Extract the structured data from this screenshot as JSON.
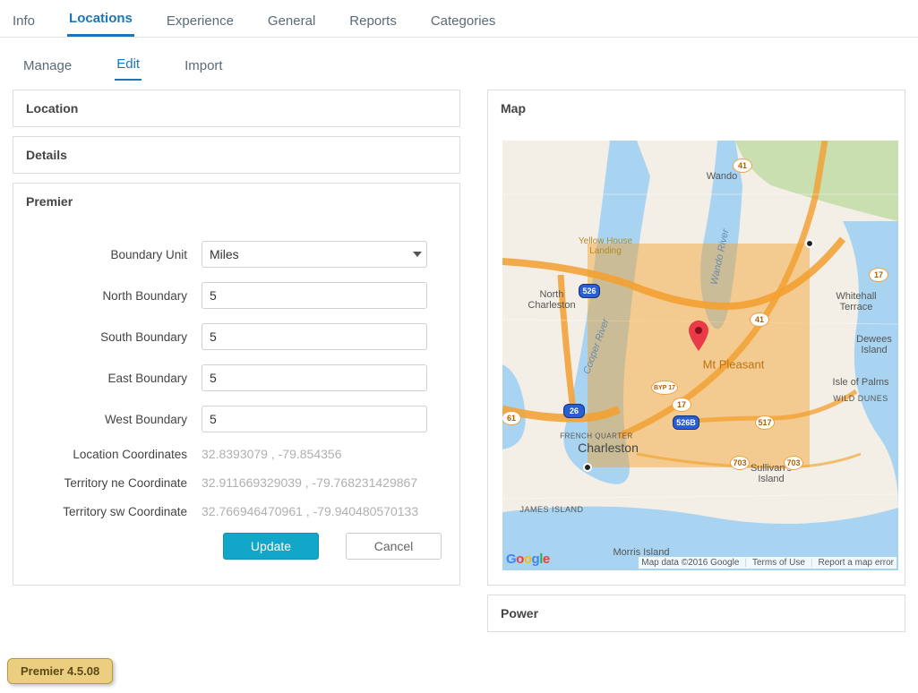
{
  "topnav": {
    "items": [
      "Info",
      "Locations",
      "Experience",
      "General",
      "Reports",
      "Categories"
    ],
    "active_index": 1
  },
  "subnav": {
    "items": [
      "Manage",
      "Edit",
      "Import"
    ],
    "active_index": 1
  },
  "left": {
    "location_header": "Location",
    "details_header": "Details",
    "premier_header": "Premier"
  },
  "form": {
    "boundary_unit_label": "Boundary Unit",
    "boundary_unit_value": "Miles",
    "north_label": "North Boundary",
    "north_value": "5",
    "south_label": "South Boundary",
    "south_value": "5",
    "east_label": "East Boundary",
    "east_value": "5",
    "west_label": "West Boundary",
    "west_value": "5",
    "loc_coords_label": "Location Coordinates",
    "loc_coords_value": "32.8393079 , -79.854356",
    "ne_label": "Territory ne Coordinate",
    "ne_value": "32.911669329039 , -79.768231429867",
    "sw_label": "Territory sw Coordinate",
    "sw_value": "32.766946470961 , -79.940480570133",
    "update_btn": "Update",
    "cancel_btn": "Cancel"
  },
  "right": {
    "map_header": "Map",
    "power_header": "Power"
  },
  "map": {
    "attribution": "Map data ©2016 Google",
    "terms": "Terms of Use",
    "report": "Report a map error",
    "labels": {
      "charleston": "Charleston",
      "north_charleston": "North\nCharleston",
      "mt_pleasant": "Mt Pleasant",
      "wando": "Wando",
      "whitehall": "Whitehall\nTerrace",
      "dewees": "Dewees\nIsland",
      "iop": "Isle of Palms",
      "wild_dunes": "WILD DUNES",
      "sullivans": "Sullivan's\nIsland",
      "morris": "Morris Island",
      "james": "JAMES ISLAND",
      "french": "FRENCH QUARTER",
      "yellow_house": "Yellow House\nLanding",
      "cooper": "Cooper River",
      "wando_river": "Wando River"
    },
    "shields": {
      "i526": "526",
      "i26": "26",
      "us17a": "17",
      "us17b": "17",
      "us41": "41",
      "sc61": "61",
      "sc517": "517",
      "sc703": "703",
      "sc526b": "526B",
      "byp17": "BYP 17"
    }
  },
  "version": {
    "label": "Premier 4.5.08"
  }
}
